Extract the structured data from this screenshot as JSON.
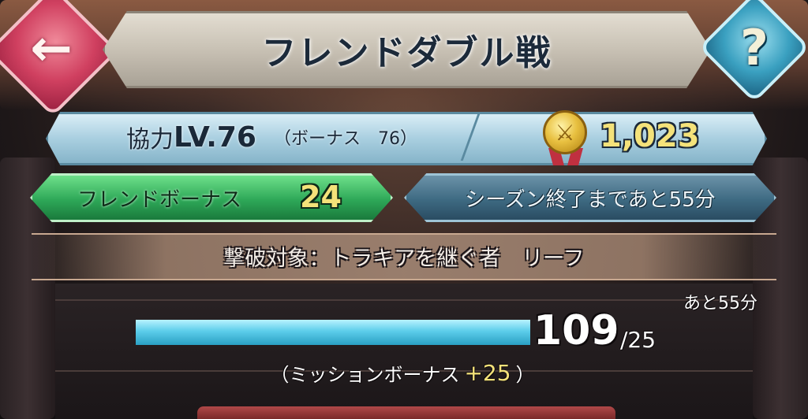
{
  "header": {
    "title": "フレンドダブル戦",
    "back_icon": "←",
    "help_icon": "?"
  },
  "level_bar": {
    "label_prefix": "協力",
    "level_text": "LV.76",
    "bonus_text": "（ボーナス　76）",
    "score": "1,023"
  },
  "friend_bonus": {
    "label": "フレンドボーナス",
    "value": "24"
  },
  "season": {
    "remaining_label": "シーズン終了まであと55分"
  },
  "target": {
    "text": "撃破対象：トラキアを継ぐ者　リーフ"
  },
  "progress": {
    "remaining": "あと55分",
    "current": "109",
    "target_text": "/25",
    "current_num": 109,
    "target_num": 25,
    "mission_prefix": "（ミッションボーナス",
    "mission_value": "+25",
    "mission_suffix": "）"
  },
  "colors": {
    "accent_gold": "#f4e27a",
    "friend_green": "#2ea858",
    "progress_blue": "#5ccdea"
  }
}
